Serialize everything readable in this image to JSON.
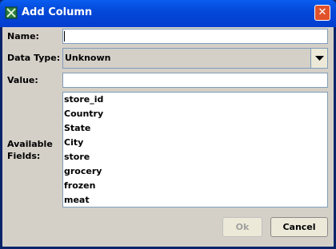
{
  "window": {
    "title": "Add Column",
    "close_glyph": "✕",
    "icon": "column-app-icon"
  },
  "form": {
    "name_label": "Name:",
    "name_value": "",
    "data_type_label": "Data Type:",
    "data_type_value": "Unknown",
    "value_label": "Value:",
    "value_value": "",
    "available_fields_label": "Available Fields:"
  },
  "available_fields": [
    "store_id",
    "Country",
    "State",
    "City",
    "store",
    "grocery",
    "frozen",
    "meat"
  ],
  "buttons": {
    "ok_label": "Ok",
    "cancel_label": "Cancel"
  },
  "colors": {
    "titlebar": "#0348d8",
    "close_button": "#e0522c",
    "dialog_background": "#d4d0c8",
    "field_border": "#7f9db9"
  }
}
